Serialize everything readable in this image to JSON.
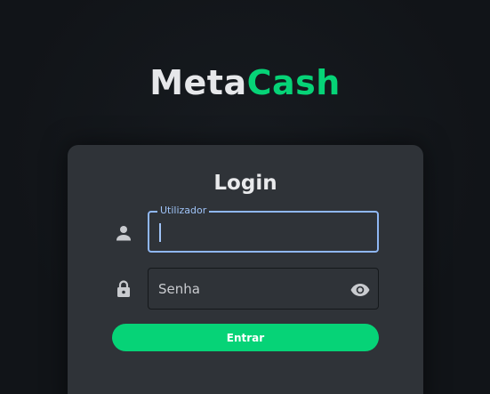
{
  "brand": {
    "part1": "Meta",
    "part2": "Cash"
  },
  "login": {
    "title": "Login",
    "username": {
      "label": "Utilizador",
      "value": "",
      "icon": "person-icon"
    },
    "password": {
      "placeholder": "Senha",
      "value": "",
      "icon": "lock-icon",
      "toggle_icon": "eye-icon"
    },
    "submit_label": "Entrar"
  },
  "colors": {
    "background": "#111418",
    "card": "#2f3338",
    "accent": "#06d377",
    "focus_border": "#8fb7f3"
  }
}
